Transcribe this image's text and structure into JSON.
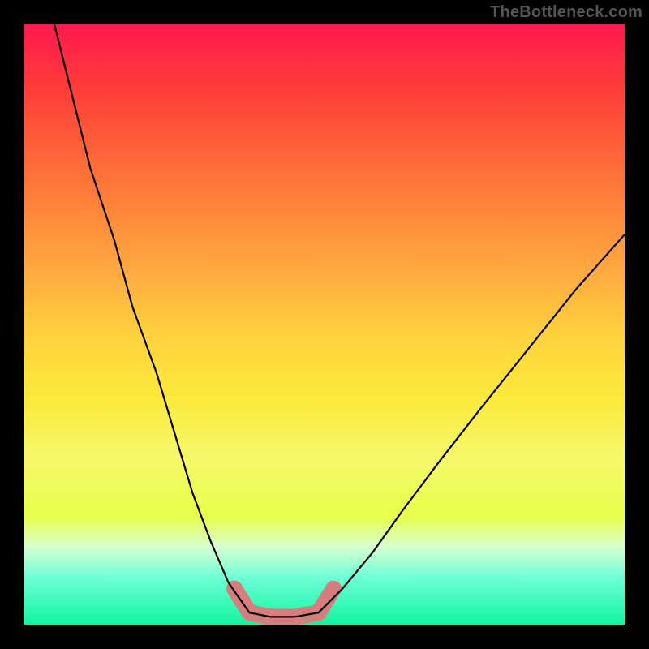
{
  "watermark": "TheBottleneck.com",
  "colors": {
    "frame": "#000000",
    "curve": "#000000",
    "highlight": "#d67d7d"
  },
  "chart_data": {
    "type": "line",
    "title": "",
    "xlabel": "",
    "ylabel": "",
    "xlim": [
      0,
      100
    ],
    "ylim": [
      0,
      100
    ],
    "grid": false,
    "legend": false,
    "series": [
      {
        "name": "left-branch",
        "x": [
          5,
          8,
          11,
          15,
          18,
          22,
          25,
          28,
          31,
          34,
          37.5
        ],
        "y": [
          100,
          88,
          76,
          64,
          53,
          42,
          32,
          22,
          14,
          7,
          2
        ]
      },
      {
        "name": "floor",
        "x": [
          37.5,
          41,
          45,
          49
        ],
        "y": [
          2,
          1.3,
          1.3,
          2
        ]
      },
      {
        "name": "right-branch",
        "x": [
          49,
          53,
          58,
          63,
          69,
          76,
          84,
          92,
          100
        ],
        "y": [
          2,
          6,
          12,
          19,
          27,
          36,
          46,
          56,
          65
        ]
      }
    ],
    "highlight_segment": {
      "x": [
        35,
        37.5,
        41,
        45,
        49,
        51.5
      ],
      "y": [
        6,
        2,
        1.3,
        1.3,
        2,
        6
      ]
    }
  }
}
